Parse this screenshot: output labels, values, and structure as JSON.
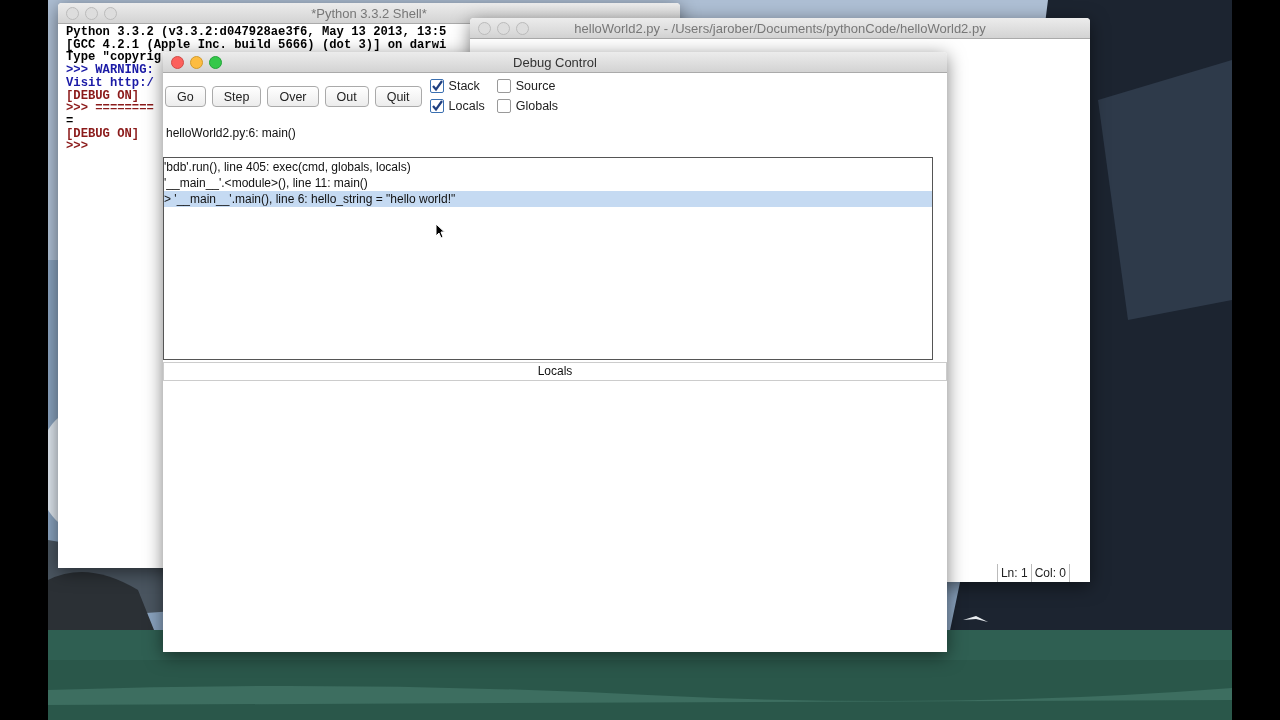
{
  "shell_window": {
    "title": "*Python 3.3.2 Shell*",
    "lines": [
      {
        "text": "Python 3.3.2 (v3.3.2:d047928ae3f6, May 13 2013, 13:5",
        "color": "#000000"
      },
      {
        "text": "[GCC 4.2.1 (Apple Inc. build 5666) (dot 3)] on darwi",
        "color": "#000000"
      },
      {
        "text": "Type \"copyrig",
        "color": "#000000"
      },
      {
        "text": ">>> WARNING:",
        "color": "#1a1aa6"
      },
      {
        "text": "Visit http:/",
        "color": "#1a1aa6"
      },
      {
        "text": "[DEBUG ON]",
        "color": "#8b1a1a"
      },
      {
        "text": ">>> ========",
        "color": "#8b1a1a"
      },
      {
        "text": "=",
        "color": "#000000"
      },
      {
        "text": "[DEBUG ON]",
        "color": "#8b1a1a"
      },
      {
        "text": ">>>",
        "color": "#8b1a1a"
      }
    ]
  },
  "editor_window": {
    "title": "helloWorld2.py - /Users/jarober/Documents/pythonCode/helloWorld2.py",
    "status_bar": [
      "Ln: 1",
      "Col: 0"
    ]
  },
  "debug_window": {
    "title": "Debug Control",
    "buttons": [
      "Go",
      "Step",
      "Over",
      "Out",
      "Quit"
    ],
    "checkboxes": [
      {
        "label": "Stack",
        "checked": true
      },
      {
        "label": "Source",
        "checked": false
      },
      {
        "label": "Locals",
        "checked": true
      },
      {
        "label": "Globals",
        "checked": false
      }
    ],
    "status": "helloWorld2.py:6: main()",
    "stack": [
      {
        "text": "'bdb'.run(), line 405: exec(cmd, globals, locals)",
        "selected": false
      },
      {
        "text": "'__main__'.<module>(), line 11: main()",
        "selected": false
      },
      {
        "text": "> '__main__'.main(), line 6: hello_string = \"hello world!\"",
        "selected": true
      }
    ],
    "locals_header": "Locals"
  }
}
